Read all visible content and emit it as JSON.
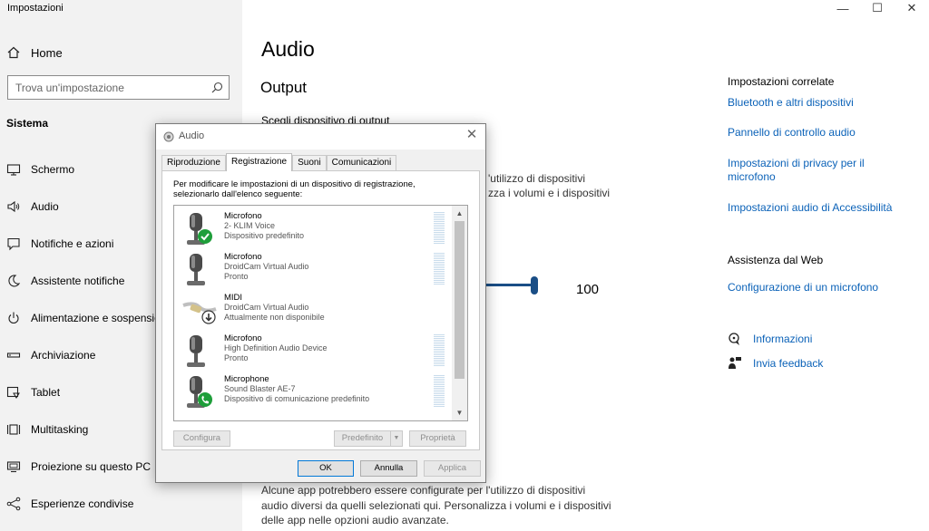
{
  "window": {
    "title": "Impostazioni",
    "controls": [
      "—",
      "☐",
      "✕"
    ]
  },
  "sidebar": {
    "home_label": "Home",
    "search_placeholder": "Trova un'impostazione",
    "section": "Sistema",
    "items": [
      {
        "label": "Schermo",
        "icon": "monitor-icon"
      },
      {
        "label": "Audio",
        "icon": "speaker-icon"
      },
      {
        "label": "Notifiche e azioni",
        "icon": "notification-icon"
      },
      {
        "label": "Assistente notifiche",
        "icon": "moon-icon"
      },
      {
        "label": "Alimentazione e sospensione",
        "icon": "power-icon"
      },
      {
        "label": "Archiviazione",
        "icon": "storage-icon"
      },
      {
        "label": "Tablet",
        "icon": "tablet-icon"
      },
      {
        "label": "Multitasking",
        "icon": "multitasking-icon"
      },
      {
        "label": "Proiezione su questo PC",
        "icon": "projection-icon"
      },
      {
        "label": "Esperienze condivise",
        "icon": "share-icon"
      }
    ]
  },
  "main": {
    "title": "Audio",
    "output_heading": "Output",
    "choose_output_label": "Scegli dispositivo di output",
    "partial_line1": "'utilizzo di dispositivi",
    "partial_line2": "zza i volumi e i dispositivi",
    "volume_value": "100",
    "bottom_para_line1": "Alcune app potrebbero essere configurate per l'utilizzo di dispositivi",
    "bottom_para_line2": "audio diversi da quelli selezionati qui. Personalizza i volumi e i dispositivi",
    "bottom_para_line3": "delle app nelle opzioni audio avanzate."
  },
  "related": {
    "heading": "Impostazioni correlate",
    "links": [
      "Bluetooth e altri dispositivi",
      "Pannello di controllo audio",
      "Impostazioni di privacy per il microfono",
      "Impostazioni audio di Accessibilità"
    ],
    "web_heading": "Assistenza dal Web",
    "web_link": "Configurazione di un microfono",
    "info_label": "Informazioni",
    "feedback_label": "Invia feedback"
  },
  "dialog": {
    "title": "Audio",
    "tabs": [
      "Riproduzione",
      "Registrazione",
      "Suoni",
      "Comunicazioni"
    ],
    "active_tab": "Registrazione",
    "instructions": "Per modificare le impostazioni di un dispositivo di registrazione, selezionarlo dall'elenco seguente:",
    "devices": [
      {
        "name": "Microfono",
        "sub": "2- KLIM Voice",
        "status": "Dispositivo predefinito",
        "icon": "microphone-icon",
        "badge": "default-check-badge"
      },
      {
        "name": "Microfono",
        "sub": "DroidCam Virtual Audio",
        "status": "Pronto",
        "icon": "microphone-icon",
        "badge": ""
      },
      {
        "name": "MIDI",
        "sub": "DroidCam Virtual Audio",
        "status": "Attualmente non disponibile",
        "icon": "midi-cable-icon",
        "badge": "unavailable-arrow-badge"
      },
      {
        "name": "Microfono",
        "sub": "High Definition Audio Device",
        "status": "Pronto",
        "icon": "microphone-icon",
        "badge": ""
      },
      {
        "name": "Microphone",
        "sub": "Sound Blaster AE-7",
        "status": "Dispositivo di comunicazione predefinito",
        "icon": "microphone-icon",
        "badge": "communication-phone-badge"
      }
    ],
    "buttons": {
      "configure": "Configura",
      "default": "Predefinito",
      "properties": "Proprietà",
      "ok": "OK",
      "cancel": "Annulla",
      "apply": "Applica"
    }
  },
  "colors": {
    "link": "#0b62b8",
    "accent": "#1a4e86",
    "sidebar_bg": "#f2f2f2",
    "check_green": "#1e9e3a"
  }
}
